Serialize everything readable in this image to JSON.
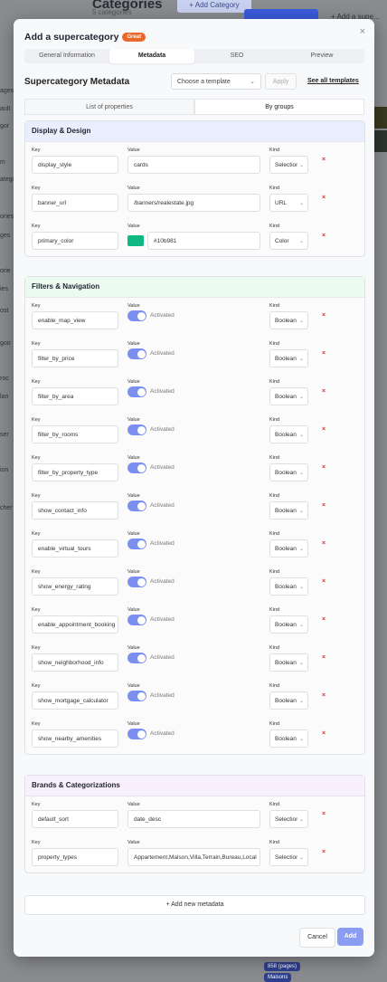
{
  "background": {
    "title": "Categories",
    "subtitle": "5 categories",
    "add_category": "+ Add Category",
    "add_text": "+ Add a supe...",
    "left_fragments": [
      "ages",
      "ault",
      "gor",
      "m",
      "ategor",
      "ories",
      "ges",
      "orie",
      "ies",
      "ost",
      "goo",
      "roc",
      "lan",
      "ser",
      "ion",
      "cher"
    ],
    "tags": [
      "858 (pages)",
      "Maisons"
    ]
  },
  "modal": {
    "title": "Add a supercategory",
    "badge": "Great",
    "close_icon": "×",
    "tabs": [
      {
        "label": "General Information",
        "active": false
      },
      {
        "label": "Metadata",
        "active": true
      },
      {
        "label": "SEO",
        "active": false
      },
      {
        "label": "Preview",
        "active": false
      }
    ],
    "section_title": "Supercategory Metadata",
    "template_placeholder": "Choose a template",
    "apply_label": "Apply",
    "see_all": "See all templates",
    "view_tabs": [
      {
        "label": "List of properties",
        "active": false
      },
      {
        "label": "By groups",
        "active": true
      }
    ],
    "field_labels": {
      "key": "Key",
      "value": "Value",
      "kind": "Kind"
    },
    "delete_icon": "×",
    "toggle_label": "Activated",
    "groups": [
      {
        "name": "Display & Design",
        "header_color": "#e8eefc",
        "rows": [
          {
            "key": "display_style",
            "value": "cards",
            "kind": "Selection",
            "type": "text"
          },
          {
            "key": "banner_url",
            "value": "/banners/realestate.jpg",
            "kind": "URL",
            "type": "text"
          },
          {
            "key": "primary_color",
            "value": "#10b981",
            "kind": "Color",
            "type": "color"
          }
        ]
      },
      {
        "name": "Filters & Navigation",
        "header_color": "#ecfbf0",
        "rows": [
          {
            "key": "enable_map_view",
            "kind": "Boolean",
            "type": "bool"
          },
          {
            "key": "filter_by_price",
            "kind": "Boolean",
            "type": "bool"
          },
          {
            "key": "filter_by_area",
            "kind": "Boolean",
            "type": "bool"
          },
          {
            "key": "filter_by_rooms",
            "kind": "Boolean",
            "type": "bool"
          },
          {
            "key": "filter_by_property_type",
            "kind": "Boolean",
            "type": "bool"
          },
          {
            "key": "show_contact_info",
            "kind": "Boolean",
            "type": "bool"
          },
          {
            "key": "enable_virtual_tours",
            "kind": "Boolean",
            "type": "bool"
          },
          {
            "key": "show_energy_rating",
            "kind": "Boolean",
            "type": "bool"
          },
          {
            "key": "enable_appointment_booking",
            "kind": "Boolean",
            "type": "bool"
          },
          {
            "key": "show_neighborhood_info",
            "kind": "Boolean",
            "type": "bool"
          },
          {
            "key": "show_mortgage_calculator",
            "kind": "Boolean",
            "type": "bool"
          },
          {
            "key": "show_nearby_amenities",
            "kind": "Boolean",
            "type": "bool"
          }
        ]
      },
      {
        "name": "Brands & Categorizations",
        "header_color": "#f8f0fc",
        "rows": [
          {
            "key": "default_sort",
            "value": "date_desc",
            "kind": "Selection",
            "type": "text"
          },
          {
            "key": "property_types",
            "value": "Appartement,Maison,Villa,Terrain,Bureau,Local",
            "kind": "Selection",
            "type": "text"
          }
        ]
      }
    ],
    "add_metadata": "+ Add new metadata",
    "cancel": "Cancel",
    "add": "Add"
  }
}
